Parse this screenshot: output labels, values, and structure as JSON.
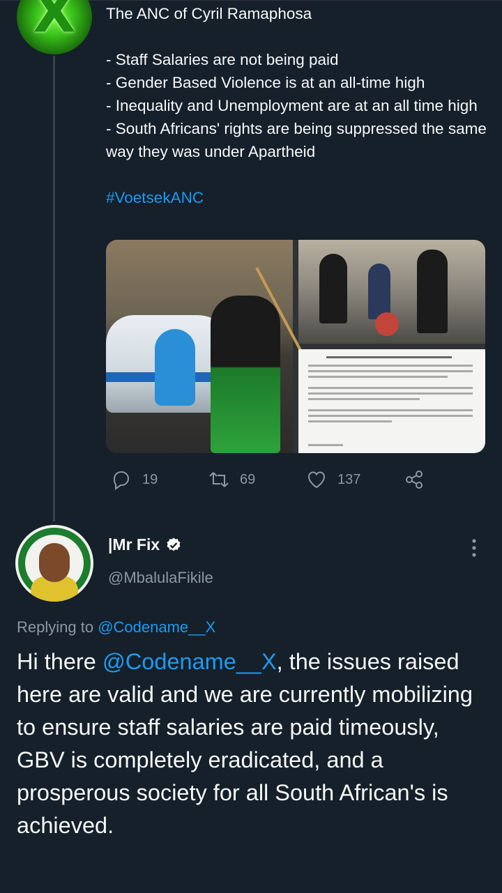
{
  "tweet1": {
    "avatar_icon": "x-logo-icon",
    "lines": [
      "The ANC of Cyril Ramaphosa",
      "",
      "- Staff Salaries are not being paid",
      "- Gender Based Violence is at an all-time high",
      "- Inequality and Unemployment are at an all time high",
      "- South Africans' rights are being suppressed the same way they was under Apartheid",
      "",
      "#VoetsekANC"
    ],
    "hashtag": "#VoetsekANC",
    "media": {
      "main_image": "police-car-confrontation-image",
      "top_right_image": "street-protest-image",
      "bottom_right_image": "salary-letter-document-image"
    },
    "actions": {
      "replies": "19",
      "retweets": "69",
      "likes": "137"
    }
  },
  "tweet2": {
    "name": "|Mr Fix",
    "handle": "@MbalulaFikile",
    "verified": true,
    "replying_prefix": "Replying to ",
    "replying_to": "@Codename__X",
    "text_before": "Hi there ",
    "mention": "@Codename__X",
    "text_after": ", the issues raised here are valid and we are currently mobilizing to ensure staff salaries are paid timeously, GBV is completely eradicated, and a prosperous society for all South African's is achieved."
  },
  "colors": {
    "background": "#15202b",
    "text": "#f7f9f9",
    "secondary": "#8b98a5",
    "link": "#1d9bf0"
  }
}
